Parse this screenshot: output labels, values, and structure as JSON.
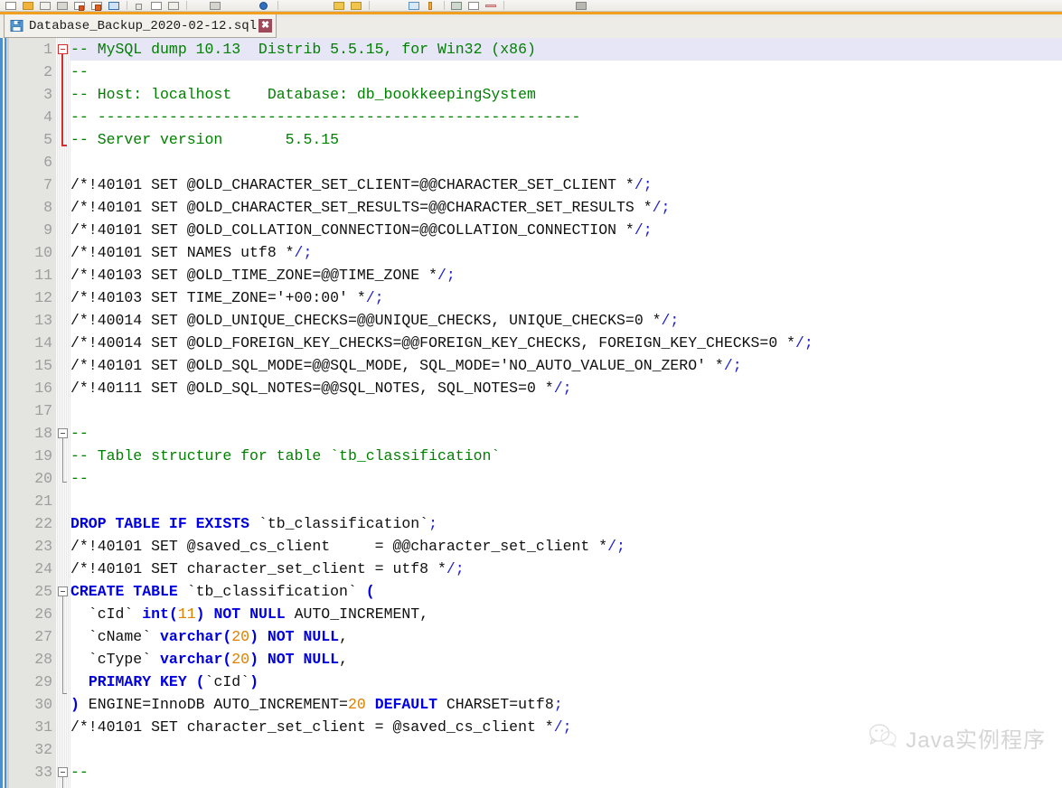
{
  "toolbar": {
    "icons": [
      "new-file-icon",
      "open-folder-icon",
      "save-icon",
      "save-all-icon",
      "close-icon",
      "close-all-icon",
      "print-icon",
      "print-now-icon",
      "cut-icon",
      "copy-icon",
      "paste-icon",
      "undo-icon",
      "redo-icon",
      "find-icon",
      "replace-icon",
      "zoom-in-icon",
      "zoom-out-icon",
      "sync-scroll-icon",
      "word-wrap-icon",
      "show-symbol-icon",
      "show-indent-icon",
      "macro-record-icon",
      "macro-play-icon"
    ]
  },
  "tab": {
    "save_icon": "floppy-disk-icon",
    "filename": "Database_Backup_2020-02-12.sql",
    "close_label": "✖"
  },
  "editor": {
    "lines": [
      {
        "n": "1",
        "tokens": [
          {
            "t": "-- MySQL dump 10.13  Distrib 5.5.15, for Win32 (x86)",
            "c": "c"
          }
        ]
      },
      {
        "n": "2",
        "tokens": [
          {
            "t": "--",
            "c": "c"
          }
        ]
      },
      {
        "n": "3",
        "tokens": [
          {
            "t": "-- Host: localhost    Database: db_bookkeepingSystem",
            "c": "c"
          }
        ]
      },
      {
        "n": "4",
        "tokens": [
          {
            "t": "-- ------------------------------------------------------",
            "c": "c"
          }
        ]
      },
      {
        "n": "5",
        "tokens": [
          {
            "t": "-- Server version\t5.5.15",
            "c": "c"
          }
        ]
      },
      {
        "n": "6",
        "tokens": []
      },
      {
        "n": "7",
        "tokens": [
          {
            "t": "/*!40101 SET @OLD_CHARACTER_SET_CLIENT=@@CHARACTER_SET_CLIENT *",
            "c": "t"
          },
          {
            "t": "/;",
            "c": "p"
          }
        ]
      },
      {
        "n": "8",
        "tokens": [
          {
            "t": "/*!40101 SET @OLD_CHARACTER_SET_RESULTS=@@CHARACTER_SET_RESULTS *",
            "c": "t"
          },
          {
            "t": "/;",
            "c": "p"
          }
        ]
      },
      {
        "n": "9",
        "tokens": [
          {
            "t": "/*!40101 SET @OLD_COLLATION_CONNECTION=@@COLLATION_CONNECTION *",
            "c": "t"
          },
          {
            "t": "/;",
            "c": "p"
          }
        ]
      },
      {
        "n": "10",
        "tokens": [
          {
            "t": "/*!40101 SET NAMES utf8 *",
            "c": "t"
          },
          {
            "t": "/;",
            "c": "p"
          }
        ]
      },
      {
        "n": "11",
        "tokens": [
          {
            "t": "/*!40103 SET @OLD_TIME_ZONE=@@TIME_ZONE *",
            "c": "t"
          },
          {
            "t": "/;",
            "c": "p"
          }
        ]
      },
      {
        "n": "12",
        "tokens": [
          {
            "t": "/*!40103 SET TIME_ZONE='+00:00' *",
            "c": "t"
          },
          {
            "t": "/;",
            "c": "p"
          }
        ]
      },
      {
        "n": "13",
        "tokens": [
          {
            "t": "/*!40014 SET @OLD_UNIQUE_CHECKS=@@UNIQUE_CHECKS, UNIQUE_CHECKS=",
            "c": "t"
          },
          {
            "t": "0",
            "c": "t"
          },
          {
            "t": " *",
            "c": "t"
          },
          {
            "t": "/;",
            "c": "p"
          }
        ]
      },
      {
        "n": "14",
        "tokens": [
          {
            "t": "/*!40014 SET @OLD_FOREIGN_KEY_CHECKS=@@FOREIGN_KEY_CHECKS, FOREIGN_KEY_CHECKS=0 *",
            "c": "t"
          },
          {
            "t": "/;",
            "c": "p"
          }
        ]
      },
      {
        "n": "15",
        "tokens": [
          {
            "t": "/*!40101 SET @OLD_SQL_MODE=@@SQL_MODE, SQL_MODE='NO_AUTO_VALUE_ON_ZERO' *",
            "c": "t"
          },
          {
            "t": "/;",
            "c": "p"
          }
        ]
      },
      {
        "n": "16",
        "tokens": [
          {
            "t": "/*!40111 SET @OLD_SQL_NOTES=@@SQL_NOTES, SQL_NOTES=0 *",
            "c": "t"
          },
          {
            "t": "/;",
            "c": "p"
          }
        ]
      },
      {
        "n": "17",
        "tokens": []
      },
      {
        "n": "18",
        "tokens": [
          {
            "t": "--",
            "c": "c"
          }
        ]
      },
      {
        "n": "19",
        "tokens": [
          {
            "t": "-- Table structure for table `tb_classification`",
            "c": "c"
          }
        ]
      },
      {
        "n": "20",
        "tokens": [
          {
            "t": "--",
            "c": "c"
          }
        ]
      },
      {
        "n": "21",
        "tokens": []
      },
      {
        "n": "22",
        "tokens": [
          {
            "t": "DROP TABLE IF EXISTS",
            "c": "k"
          },
          {
            "t": " `tb_classification`",
            "c": "t"
          },
          {
            "t": ";",
            "c": "p"
          }
        ]
      },
      {
        "n": "23",
        "tokens": [
          {
            "t": "/*!40101 SET @saved_cs_client     = @@character_set_client *",
            "c": "t"
          },
          {
            "t": "/;",
            "c": "p"
          }
        ]
      },
      {
        "n": "24",
        "tokens": [
          {
            "t": "/*!40101 SET character_set_client = utf8 *",
            "c": "t"
          },
          {
            "t": "/;",
            "c": "p"
          }
        ]
      },
      {
        "n": "25",
        "tokens": [
          {
            "t": "CREATE TABLE",
            "c": "k"
          },
          {
            "t": " `tb_classification` ",
            "c": "t"
          },
          {
            "t": "(",
            "c": "k"
          }
        ]
      },
      {
        "n": "26",
        "tokens": [
          {
            "t": "  `cId` ",
            "c": "t"
          },
          {
            "t": "int",
            "c": "k"
          },
          {
            "t": "(",
            "c": "k"
          },
          {
            "t": "11",
            "c": "n"
          },
          {
            "t": ")",
            "c": "k"
          },
          {
            "t": " ",
            "c": "t"
          },
          {
            "t": "NOT NULL",
            "c": "k"
          },
          {
            "t": " AUTO_INCREMENT,",
            "c": "t"
          }
        ]
      },
      {
        "n": "27",
        "tokens": [
          {
            "t": "  `cName` ",
            "c": "t"
          },
          {
            "t": "varchar",
            "c": "k"
          },
          {
            "t": "(",
            "c": "k"
          },
          {
            "t": "20",
            "c": "n"
          },
          {
            "t": ")",
            "c": "k"
          },
          {
            "t": " ",
            "c": "t"
          },
          {
            "t": "NOT NULL",
            "c": "k"
          },
          {
            "t": ",",
            "c": "t"
          }
        ]
      },
      {
        "n": "28",
        "tokens": [
          {
            "t": "  `cType` ",
            "c": "t"
          },
          {
            "t": "varchar",
            "c": "k"
          },
          {
            "t": "(",
            "c": "k"
          },
          {
            "t": "20",
            "c": "n"
          },
          {
            "t": ")",
            "c": "k"
          },
          {
            "t": " ",
            "c": "t"
          },
          {
            "t": "NOT NULL",
            "c": "k"
          },
          {
            "t": ",",
            "c": "t"
          }
        ]
      },
      {
        "n": "29",
        "tokens": [
          {
            "t": "  ",
            "c": "t"
          },
          {
            "t": "PRIMARY KEY",
            "c": "k"
          },
          {
            "t": " ",
            "c": "t"
          },
          {
            "t": "(",
            "c": "k"
          },
          {
            "t": "`cId`",
            "c": "t"
          },
          {
            "t": ")",
            "c": "k"
          }
        ]
      },
      {
        "n": "30",
        "tokens": [
          {
            "t": ")",
            "c": "k"
          },
          {
            "t": " ENGINE=InnoDB AUTO_INCREMENT=",
            "c": "t"
          },
          {
            "t": "20",
            "c": "n"
          },
          {
            "t": " ",
            "c": "t"
          },
          {
            "t": "DEFAULT",
            "c": "k"
          },
          {
            "t": " CHARSET=utf8",
            "c": "t"
          },
          {
            "t": ";",
            "c": "p"
          }
        ]
      },
      {
        "n": "31",
        "tokens": [
          {
            "t": "/*!40101 SET character_set_client = @saved_cs_client *",
            "c": "t"
          },
          {
            "t": "/;",
            "c": "p"
          }
        ]
      },
      {
        "n": "32",
        "tokens": []
      },
      {
        "n": "33",
        "tokens": [
          {
            "t": "--",
            "c": "c"
          }
        ]
      }
    ],
    "current_line": 1,
    "colors": {
      "comment": "#008000",
      "keyword": "#0000e0",
      "number": "#e08000",
      "punctuation": "#2222cc",
      "plain": "#101010",
      "line_number": "#9d9d9d",
      "gutter_bg": "#e4e4e0",
      "current_line_bg": "#e6e6f7",
      "fold_active": "#d03030",
      "tab_accent": "#f0a01e"
    }
  },
  "watermark": {
    "logo": "wechat-icon",
    "text": "Java实例程序"
  }
}
